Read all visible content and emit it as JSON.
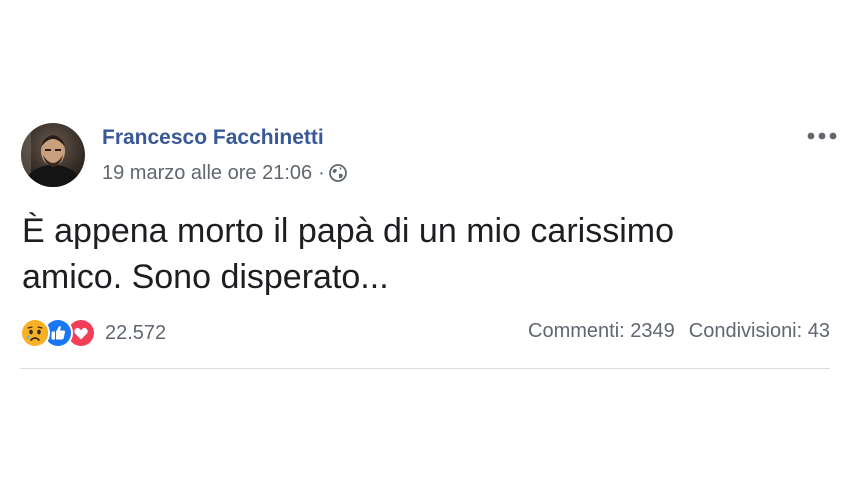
{
  "post": {
    "author": "Francesco Facchinetti",
    "timestamp": "19 marzo alle ore 21:06",
    "separator": "·",
    "privacy_icon": "globe-icon",
    "more_icon": "more-options-icon",
    "text_line1": "È appena morto il papà di un mio carissimo",
    "text_line2": "amico. Sono disperato...",
    "reactions": {
      "icons": [
        "sad-reaction-icon",
        "like-reaction-icon",
        "love-reaction-icon"
      ],
      "count": "22.572"
    },
    "stats": {
      "comments": "Commenti: 2349",
      "shares": "Condivisioni: 43"
    }
  },
  "colors": {
    "author": "#385898",
    "meta": "#606770",
    "like": "#1877f2",
    "love": "#f33e58",
    "sad": "#f7b125",
    "divider": "#dadde1"
  }
}
